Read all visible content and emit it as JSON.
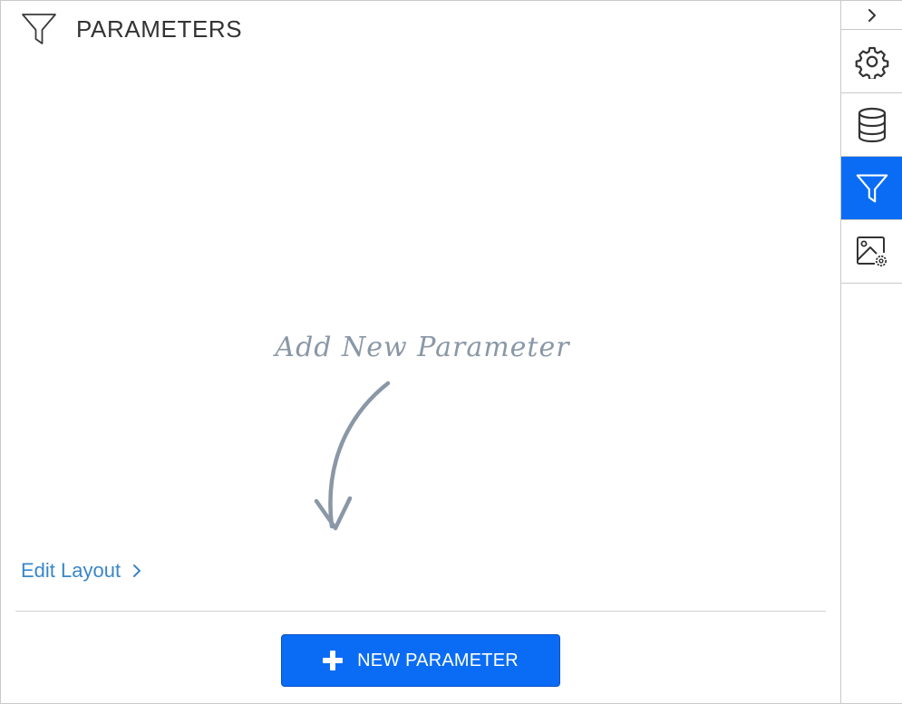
{
  "panel": {
    "title": "PARAMETERS",
    "header_icon": "filter-icon",
    "hint_text": "Add New Parameter",
    "edit_layout_label": "Edit Layout",
    "new_parameter_label": "NEW PARAMETER"
  },
  "sidebar": {
    "collapse_icon": "chevron-right-icon",
    "tabs": [
      {
        "id": "settings",
        "icon": "gear-icon",
        "active": false
      },
      {
        "id": "data",
        "icon": "database-icon",
        "active": false
      },
      {
        "id": "filter",
        "icon": "filter-icon",
        "active": true
      },
      {
        "id": "image-settings",
        "icon": "image-settings-icon",
        "active": false
      }
    ]
  },
  "colors": {
    "accent": "#0a6cf5",
    "link": "#3a86c8",
    "text": "#333333",
    "hint": "#8a97a6",
    "border": "#c9c9c9"
  }
}
